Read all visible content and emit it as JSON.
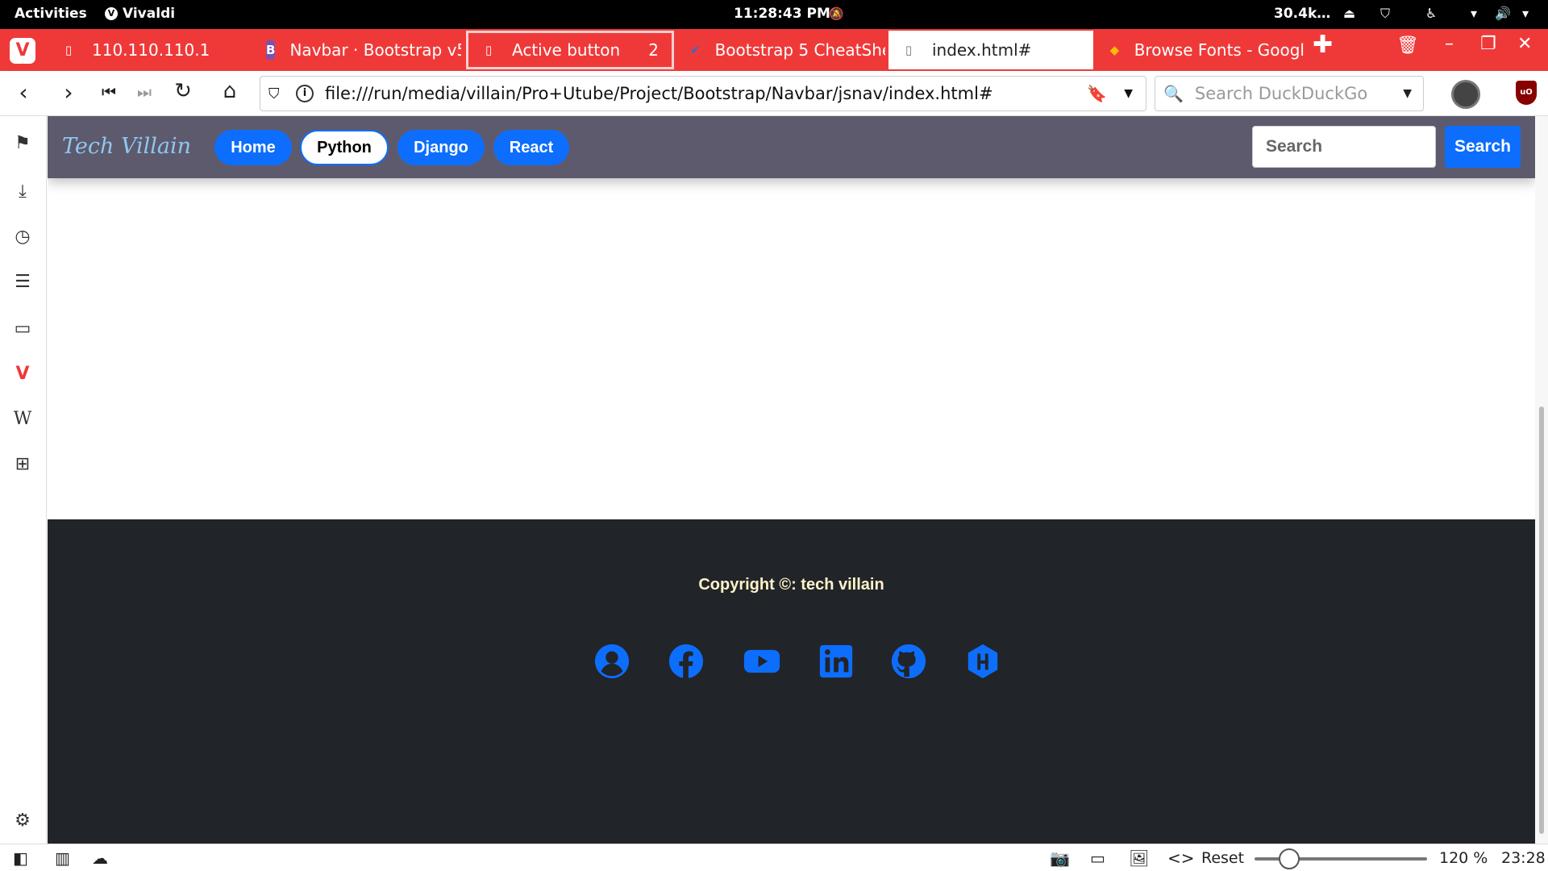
{
  "system": {
    "activities": "Activities",
    "app_name": "Vivaldi",
    "clock": "11:28:43 PM",
    "net_speed": "30.4k…"
  },
  "tabs": [
    {
      "title": "110.110.110.1"
    },
    {
      "title": "Navbar · Bootstrap v5"
    },
    {
      "title": "Active button",
      "count": "2"
    },
    {
      "title": "Bootstrap 5 CheatShe"
    },
    {
      "title": "index.html#"
    },
    {
      "title": "Browse Fonts - Googl"
    }
  ],
  "address": {
    "url": "file:///run/media/villain/Pro+Utube/Project/Bootstrap/Navbar/jsnav/index.html#",
    "search_placeholder": "Search DuckDuckGo"
  },
  "site": {
    "brand": "Tech Villain",
    "nav": [
      {
        "label": "Home"
      },
      {
        "label": "Python"
      },
      {
        "label": "Django"
      },
      {
        "label": "React"
      }
    ],
    "active_nav": "Python",
    "search_placeholder": "Search",
    "search_button": "Search",
    "footer_copyright": "Copyright ©: tech villain",
    "social_icons": [
      "user-circle-icon",
      "facebook-icon",
      "youtube-icon",
      "linkedin-icon",
      "github-icon",
      "hackerrank-icon"
    ],
    "accent_color": "#0d6efd"
  },
  "statusbar": {
    "reset": "Reset",
    "zoom": "120 %",
    "time": "23:28",
    "zoom_slider_fraction": 0.2
  }
}
